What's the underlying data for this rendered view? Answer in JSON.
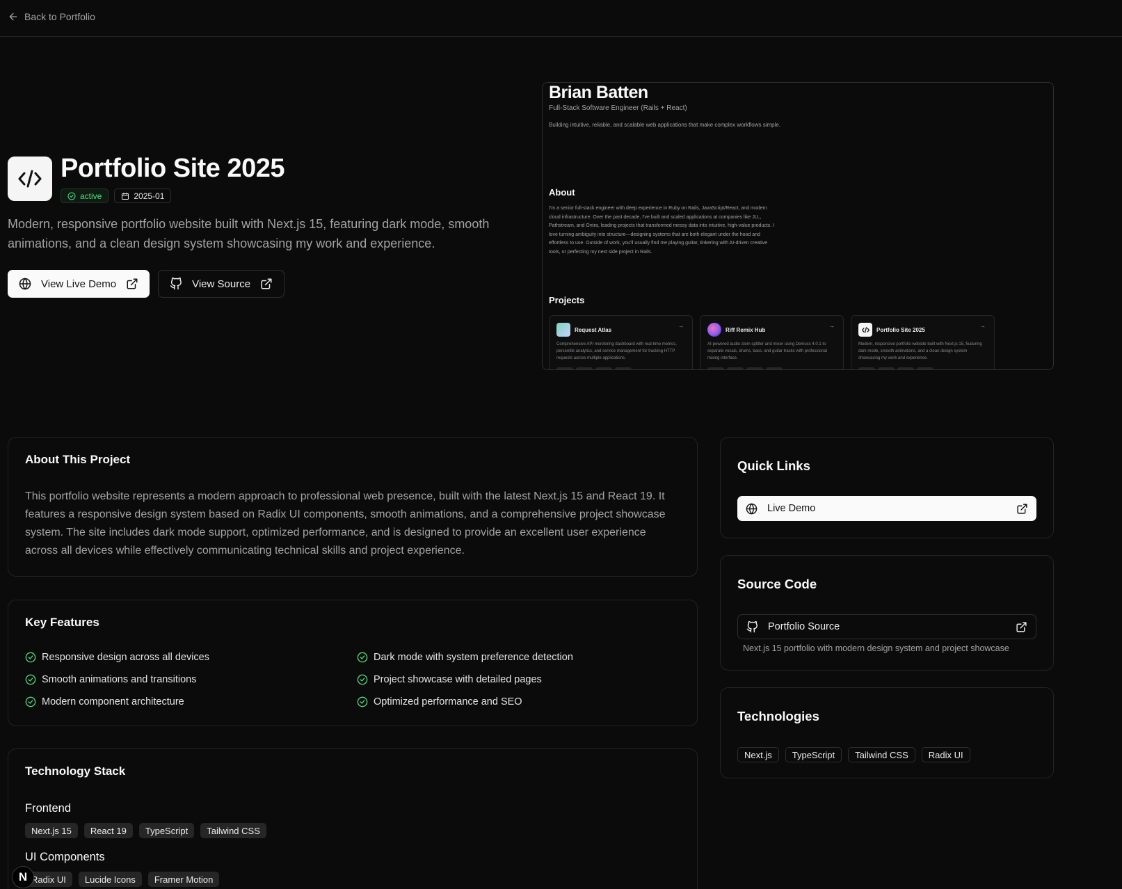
{
  "nav": {
    "back_label": "Back to Portfolio"
  },
  "hero": {
    "title": "Portfolio Site 2025",
    "status": "active",
    "date": "2025-01",
    "description": "Modern, responsive portfolio website built with Next.js 15, featuring dark mode, smooth animations, and a clean design system showcasing my work and experience.",
    "demo_button": "View Live Demo",
    "source_button": "View Source"
  },
  "preview": {
    "name": "Brian Batten",
    "role": "Full-Stack Software Engineer (Rails + React)",
    "tagline": "Building intuitive, reliable, and scalable web applications that make complex workflows simple.",
    "about_heading": "About",
    "about_text": "I'm a senior full-stack engineer with deep experience in Ruby on Rails, JavaScript/React, and modern cloud infrastructure. Over the past decade, I've built and scaled applications at companies like JLL, Pathstream, and Ontra, leading projects that transformed messy data into intuitive, high-value products. I love turning ambiguity into structure—designing systems that are both elegant under the hood and effortless to use. Outside of work, you'll usually find me playing guitar, tinkering with AI-driven creative tools, or perfecting my next side project in Rails.",
    "projects_heading": "Projects",
    "projects": [
      {
        "title": "Request Atlas",
        "desc": "Comprehensive API monitoring dashboard with real-time metrics, percentile analytics, and service management for tracking HTTP requests across multiple applications."
      },
      {
        "title": "Riff Remix Hub",
        "desc": "AI-powered audio stem splitter and mixer using Demucs 4.0.1 to separate vocals, drums, bass, and guitar tracks with professional mixing interface."
      },
      {
        "title": "Portfolio Site 2025",
        "desc": "Modern, responsive portfolio website built with Next.js 15, featuring dark mode, smooth animations, and a clean design system showcasing my work and experience."
      }
    ]
  },
  "about": {
    "heading": "About This Project",
    "body": "This portfolio website represents a modern approach to professional web presence, built with the latest Next.js 15 and React 19. It features a responsive design system based on Radix UI components, smooth animations, and a comprehensive project showcase system. The site includes dark mode support, optimized performance, and is designed to provide an excellent user experience across all devices while effectively communicating technical skills and project experience."
  },
  "features": {
    "heading": "Key Features",
    "items": [
      "Responsive design across all devices",
      "Dark mode with system preference detection",
      "Smooth animations and transitions",
      "Project showcase with detailed pages",
      "Modern component architecture",
      "Optimized performance and SEO"
    ]
  },
  "stack": {
    "heading": "Technology Stack",
    "groups": [
      {
        "title": "Frontend",
        "items": [
          "Next.js 15",
          "React 19",
          "TypeScript",
          "Tailwind CSS"
        ]
      },
      {
        "title": "UI Components",
        "items": [
          "Radix UI",
          "Lucide Icons",
          "Framer Motion"
        ]
      }
    ]
  },
  "quick_links": {
    "heading": "Quick Links",
    "live_demo": "Live Demo"
  },
  "source_code": {
    "heading": "Source Code",
    "link_label": "Portfolio Source",
    "description": "Next.js 15 portfolio with modern design system and project showcase"
  },
  "technologies": {
    "heading": "Technologies",
    "items": [
      "Next.js",
      "TypeScript",
      "Tailwind CSS",
      "Radix UI"
    ]
  },
  "dev_badge": {
    "letter": "N"
  },
  "colors": {
    "accent_green": "#4ade80",
    "background": "#0b0b0b",
    "muted_text": "#a3a3a3"
  }
}
